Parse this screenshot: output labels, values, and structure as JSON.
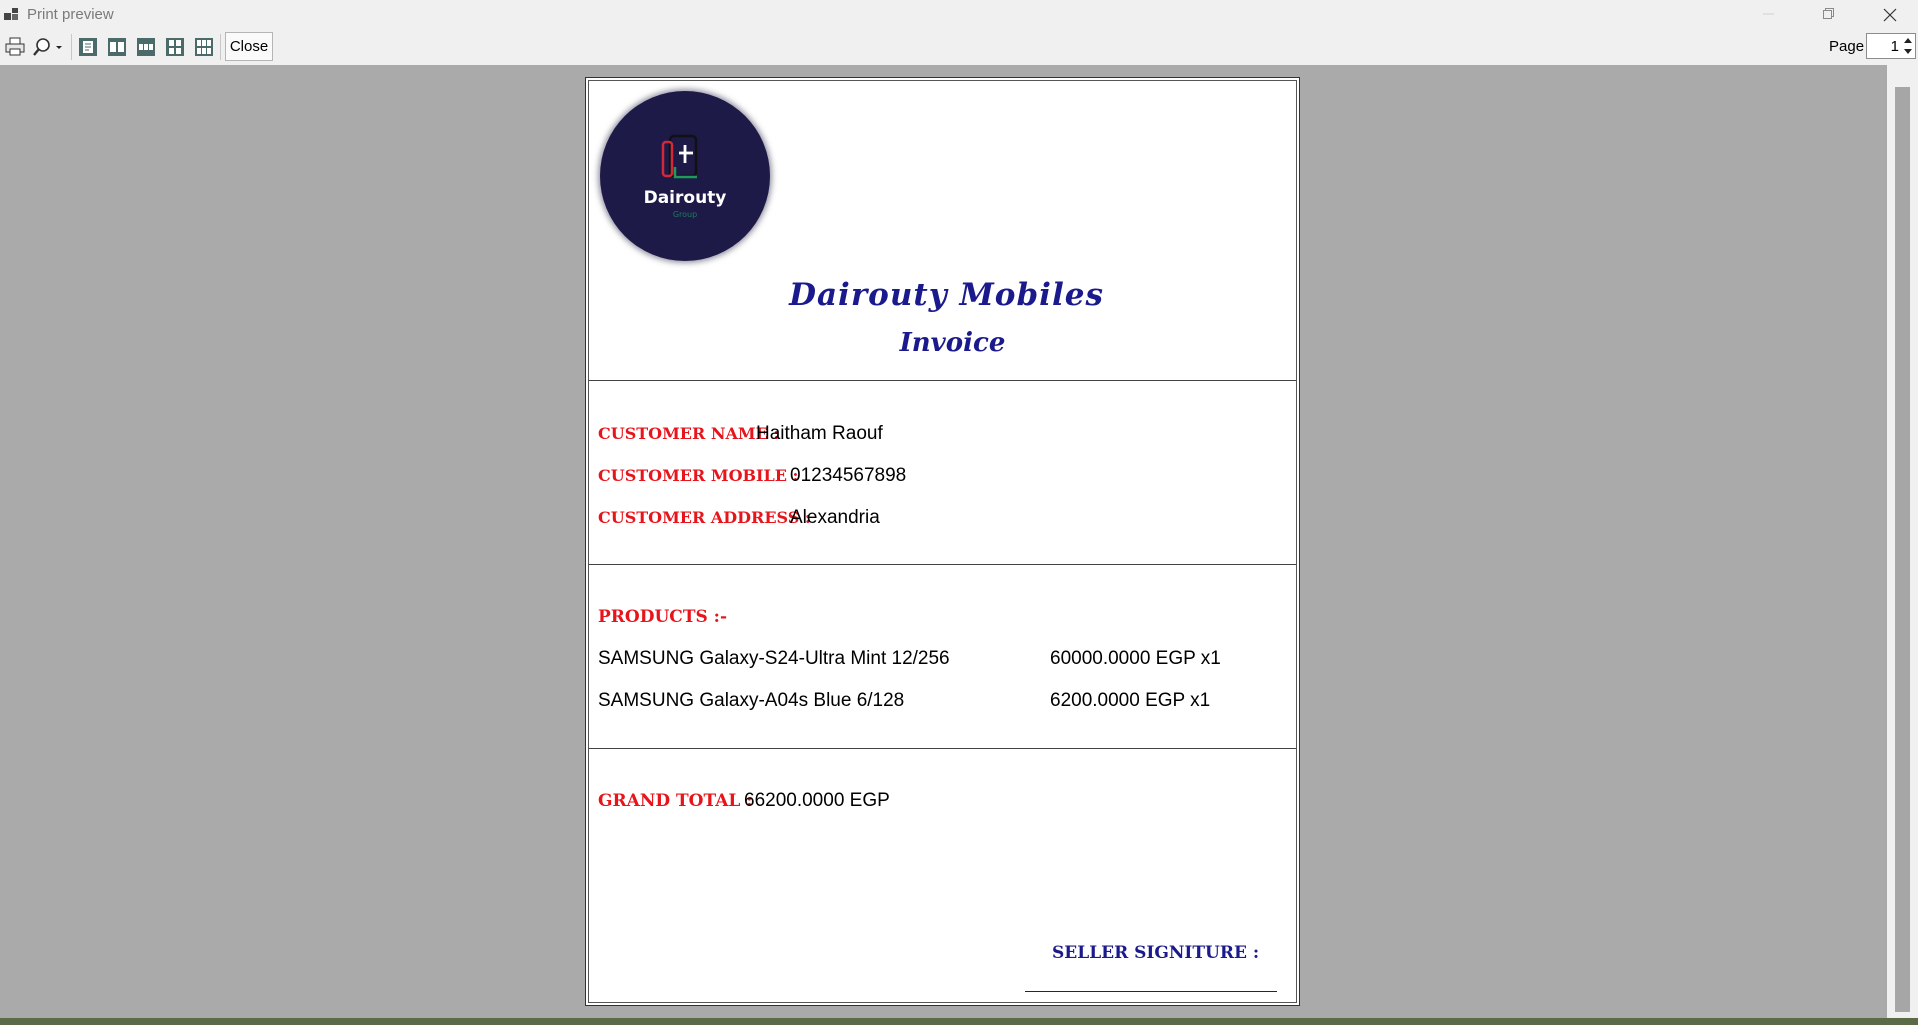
{
  "window": {
    "title": "Print preview"
  },
  "toolbar": {
    "icons": [
      "printer-icon",
      "zoom-icon",
      "one-page-icon",
      "two-pages-icon",
      "three-pages-icon",
      "four-pages-icon",
      "six-pages-icon"
    ],
    "close_label": "Close",
    "page_label": "Page",
    "page_value": "1"
  },
  "invoice": {
    "logo": {
      "name": "Dairouty",
      "sub": "Group"
    },
    "company_name": "Dairouty Mobiles",
    "title": "Invoice",
    "customer": {
      "name_label": "CUSTOMER NAME :",
      "name": "Haitham Raouf",
      "mobile_label": "CUSTOMER MOBILE :",
      "mobile": "01234567898",
      "address_label": "CUSTOMER ADDRESS :",
      "address": "Alexandria"
    },
    "products_label": "PRODUCTS :-",
    "products": [
      {
        "name": "SAMSUNG Galaxy-S24-Ultra Mint 12/256",
        "price": "60000.0000 EGP x1"
      },
      {
        "name": "SAMSUNG Galaxy-A04s Blue 6/128",
        "price": "6200.0000 EGP x1"
      }
    ],
    "grand_total_label": "GRAND TOTAL :",
    "grand_total": "66200.0000 EGP",
    "seller_label": "SELLER SIGNITURE :"
  },
  "colors": {
    "accent_red": "#e8141b",
    "accent_navy": "#1a1a8c",
    "logo_bg": "#1d1a48",
    "preview_bg": "#aaaaaa"
  }
}
